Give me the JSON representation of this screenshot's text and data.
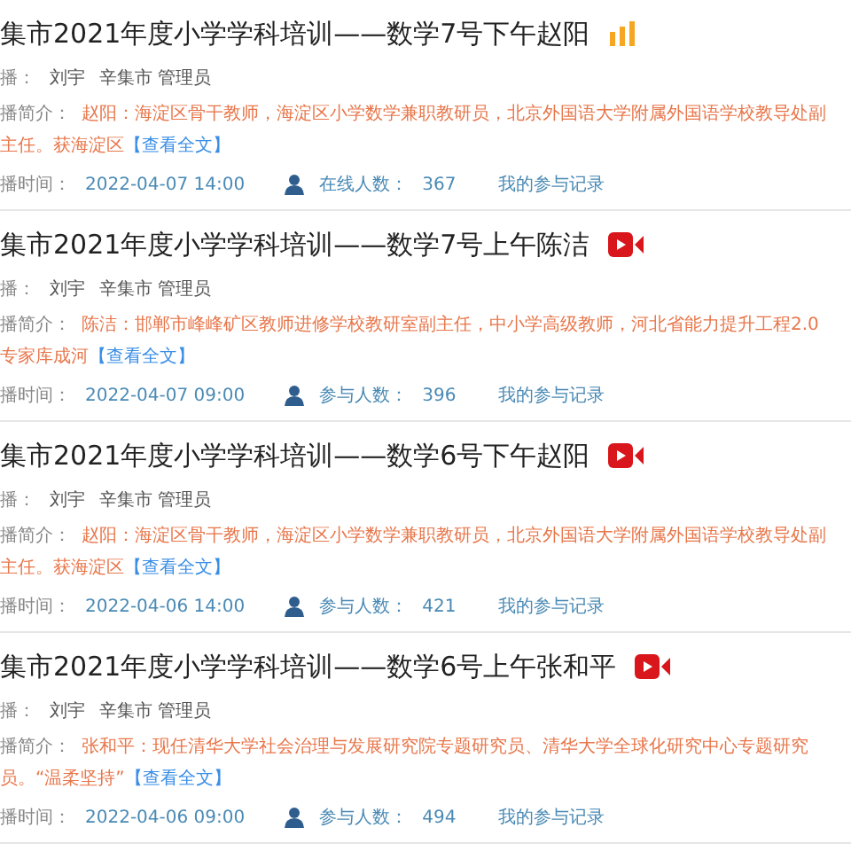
{
  "sessions": [
    {
      "title": "集市2021年度小学学科培训——数学7号下午赵阳",
      "kind": "live",
      "host_label": "播：",
      "host": "刘宇",
      "org": "辛集市 管理员",
      "intro_label": "播简介：",
      "intro": "赵阳：海淀区骨干教师，海淀区小学数学兼职教研员，北京外国语大学附属外国语学校教导处副主任。获海淀区",
      "more": "【查看全文】",
      "time_label": "播时间：",
      "time": "2022-04-07 14:00",
      "count_label": "在线人数：",
      "count": "367",
      "record": "我的参与记录"
    },
    {
      "title": "集市2021年度小学学科培训——数学7号上午陈洁",
      "kind": "video",
      "host_label": "播：",
      "host": "刘宇",
      "org": "辛集市 管理员",
      "intro_label": "播简介：",
      "intro": "陈洁：邯郸市峰峰矿区教师进修学校教研室副主任，中小学高级教师，河北省能力提升工程2.0专家库成河",
      "more": "【查看全文】",
      "time_label": "播时间：",
      "time": "2022-04-07 09:00",
      "count_label": "参与人数：",
      "count": "396",
      "record": "我的参与记录"
    },
    {
      "title": "集市2021年度小学学科培训——数学6号下午赵阳",
      "kind": "video",
      "host_label": "播：",
      "host": "刘宇",
      "org": "辛集市 管理员",
      "intro_label": "播简介：",
      "intro": "赵阳：海淀区骨干教师，海淀区小学数学兼职教研员，北京外国语大学附属外国语学校教导处副主任。获海淀区",
      "more": "【查看全文】",
      "time_label": "播时间：",
      "time": "2022-04-06 14:00",
      "count_label": "参与人数：",
      "count": "421",
      "record": "我的参与记录"
    },
    {
      "title": "集市2021年度小学学科培训——数学6号上午张和平",
      "kind": "video",
      "host_label": "播：",
      "host": "刘宇",
      "org": "辛集市 管理员",
      "intro_label": "播简介：",
      "intro": "张和平：现任清华大学社会治理与发展研究院专题研究员、清华大学全球化研究中心专题研究员。“温柔坚持”",
      "more": "【查看全文】",
      "time_label": "播时间：",
      "time": "2022-04-06 09:00",
      "count_label": "参与人数：",
      "count": "494",
      "record": "我的参与记录"
    }
  ]
}
